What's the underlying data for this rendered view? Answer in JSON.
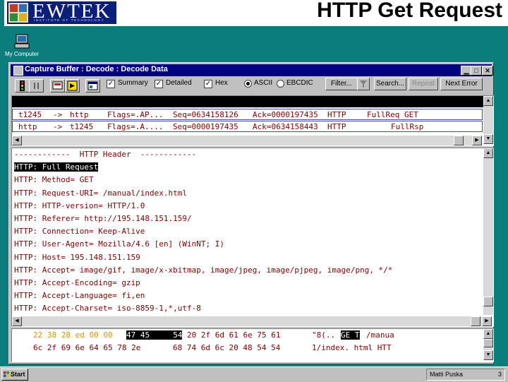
{
  "slide": {
    "title": "HTTP Get Request",
    "logo_text": "EWTEK",
    "logo_subtext": "INSTITUTE OF TECHNOLOGY"
  },
  "desktop": {
    "icons": [
      {
        "label": "My Computer",
        "icon": "my-computer-icon"
      }
    ]
  },
  "window": {
    "title": "Capture Buffer : Decode : Decode Data",
    "controls": {
      "minimize": "▁",
      "maximize": "□",
      "close": "✕"
    }
  },
  "toolbar": {
    "checkboxes": [
      {
        "label": "Summary",
        "checked": true
      },
      {
        "label": "Detailed",
        "checked": true
      },
      {
        "label": "Hex",
        "checked": true
      }
    ],
    "radios": [
      {
        "label": "ASCII",
        "selected": true
      },
      {
        "label": "EBCDIC",
        "selected": false
      }
    ],
    "buttons": {
      "filter": "Filter...",
      "search": "Search...",
      "repeat": "Repeat",
      "next_error": "Next Error"
    }
  },
  "summary": {
    "rows": [
      {
        "src": "t1245",
        "dir": "->",
        "dst": "http",
        "flags": "Flags=.AP...",
        "seq": "Seq=0634158126",
        "ack": "Ack=0000197435",
        "proto": "HTTP",
        "info": "FullReq GET"
      },
      {
        "src": "http",
        "dir": "->",
        "dst": "t1245",
        "flags": "Flags=.A....",
        "seq": "Seq=0000197435",
        "ack": "Ack=0634158443",
        "proto": "HTTP",
        "info": "FullRsp"
      }
    ]
  },
  "decode": {
    "lines": [
      "------------  HTTP Header  ------------",
      "HTTP: Full Request",
      "HTTP: Method= GET",
      "HTTP: Request-URI= /manual/index.html",
      "HTTP: HTTP-version= HTTP/1.0",
      "HTTP: Referer= http://195.148.151.159/",
      "HTTP: Connection= Keep-Alive",
      "HTTP: User-Agent= Mozilla/4.6 [en] (WinNT; I)",
      "HTTP: Host= 195.148.151.159",
      "HTTP: Accept= image/gif, image/x-xbitmap, image/jpeg, image/pjpeg, image/png, */*",
      "HTTP: Accept-Encoding= gzip",
      "HTTP: Accept-Language= fi,en",
      "HTTP: Accept-Charset= iso-8859-1,*,utf-8"
    ],
    "selected_index": 1
  },
  "hex": {
    "line1": {
      "pre": "22 38 28 ed 00 00",
      "sel": "47 45     54",
      "post": "20 2f 6d 61 6e 75 61",
      "ascii_pre": "\"8(..",
      "ascii_sel": "GE T",
      "ascii_post": "/manua"
    },
    "line2": {
      "bytes1": "6c 2f 69 6e 64 65 78 2e",
      "bytes2": "68 74 6d 6c 20 48 54 54",
      "ascii": "1/index. html HTT"
    }
  },
  "taskbar": {
    "start_label": "Start",
    "author": "Matti Puska",
    "page": "3"
  },
  "colors": {
    "desktop": "#0c7d7d",
    "titlebar": "#000080",
    "decode_text": "#800000",
    "hex_offset_text": "#d9931a",
    "row_border": "#3b43d8"
  }
}
